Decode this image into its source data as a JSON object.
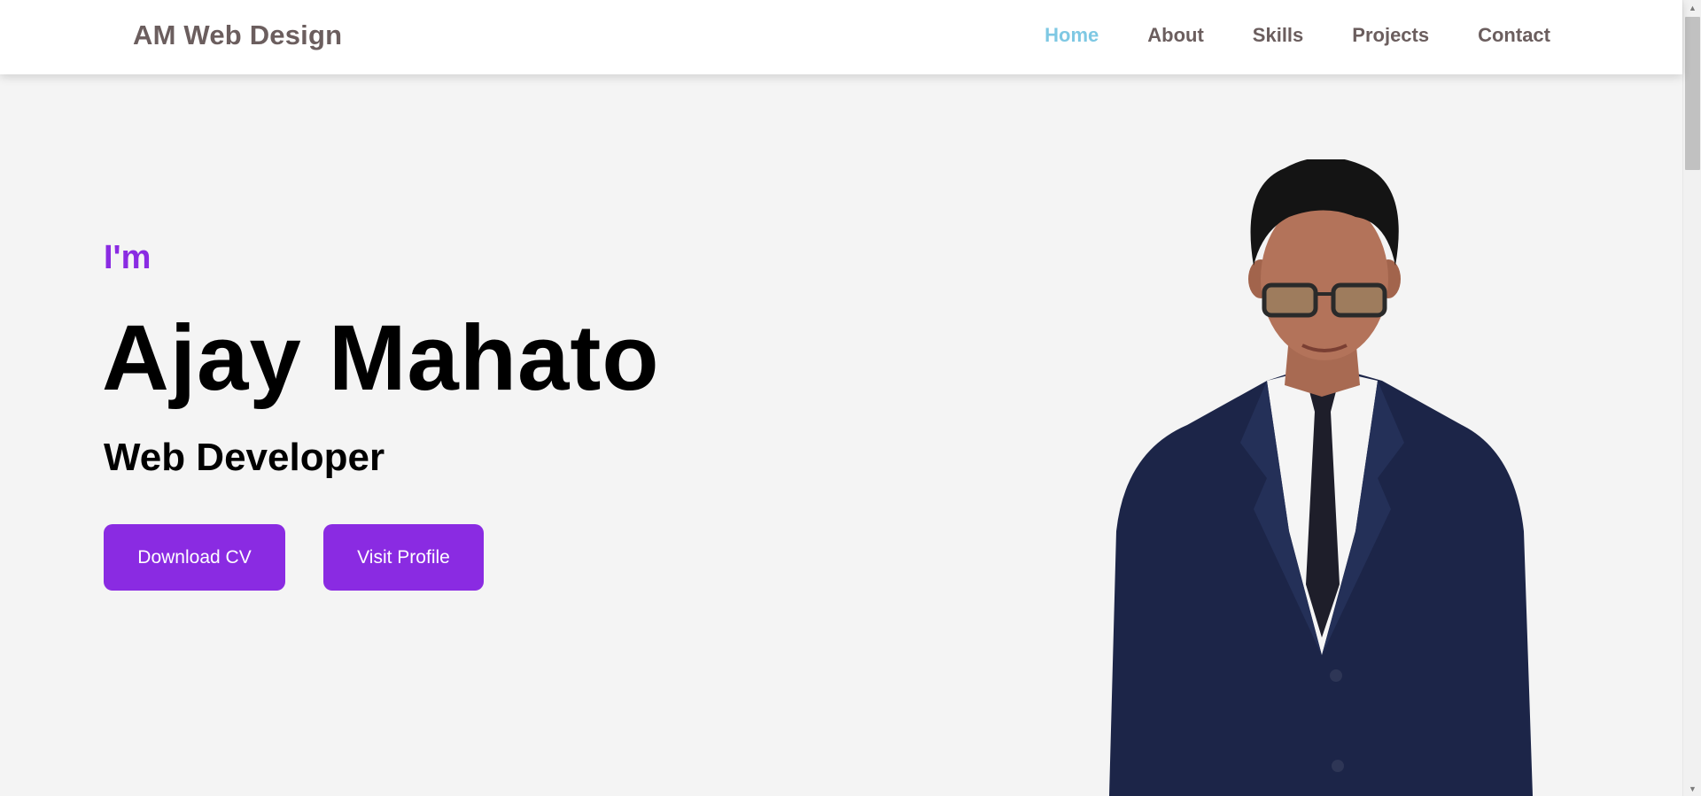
{
  "header": {
    "logo": "AM Web Design",
    "nav": [
      {
        "label": "Home",
        "active": true
      },
      {
        "label": "About",
        "active": false
      },
      {
        "label": "Skills",
        "active": false
      },
      {
        "label": "Projects",
        "active": false
      },
      {
        "label": "Contact",
        "active": false
      }
    ]
  },
  "hero": {
    "intro": "I'm",
    "name": "Ajay Mahato",
    "role": "Web Developer",
    "buttons": {
      "download_cv": "Download CV",
      "visit_profile": "Visit Profile"
    }
  },
  "colors": {
    "accent": "#8a2be2",
    "nav_active": "#7ec8e3",
    "nav_text": "#6b5e5e",
    "background": "#f4f4f4",
    "suit": "#1c2548"
  }
}
